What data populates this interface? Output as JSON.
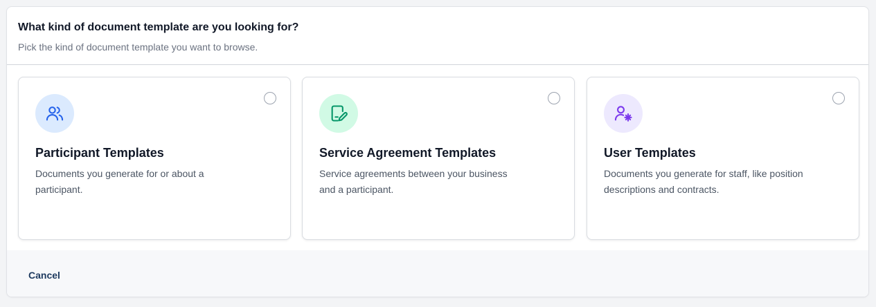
{
  "dialog": {
    "title": "What kind of document template are you looking for?",
    "subtitle": "Pick the kind of document template you want to browse."
  },
  "cards": [
    {
      "title": "Participant Templates",
      "description": "Documents you generate for or about a participant.",
      "icon": "users-icon",
      "icon_bg": "#dbeafe",
      "icon_color": "#2563eb",
      "selected": false
    },
    {
      "title": "Service Agreement Templates",
      "description": "Service agreements between your business and a participant.",
      "icon": "file-signature-icon",
      "icon_bg": "#d1fae5",
      "icon_color": "#059669",
      "selected": false
    },
    {
      "title": "User Templates",
      "description": "Documents you generate for staff, like position descriptions and contracts.",
      "icon": "user-cog-icon",
      "icon_bg": "#ede9fe",
      "icon_color": "#7c3aed",
      "selected": false
    }
  ],
  "footer": {
    "cancel_label": "Cancel"
  }
}
